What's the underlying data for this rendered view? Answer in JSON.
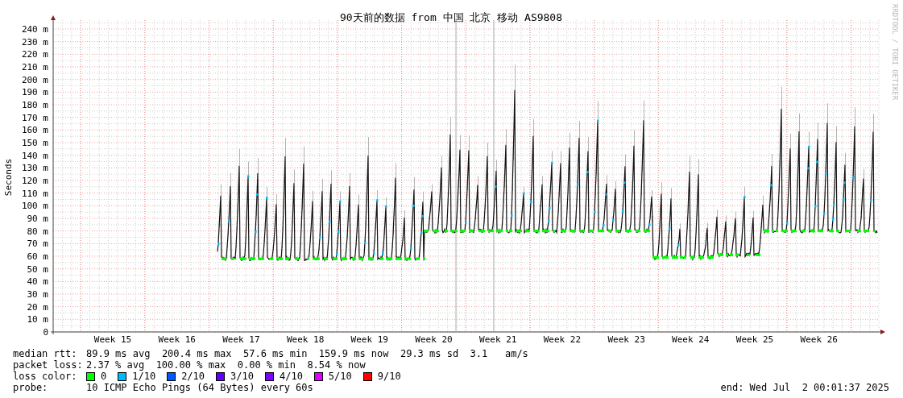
{
  "title": "90天前的数据 from 中国 北京 移动 AS9808",
  "credit": "RRDTOOL / TOBI OETIKER",
  "y_axis": {
    "label": "Seconds",
    "ticks": [
      "240 m",
      "230 m",
      "220 m",
      "210 m",
      "200 m",
      "190 m",
      "180 m",
      "170 m",
      "160 m",
      "150 m",
      "140 m",
      "130 m",
      "120 m",
      "110 m",
      "100 m",
      "90 m",
      "80 m",
      "70 m",
      "60 m",
      "50 m",
      "40 m",
      "30 m",
      "20 m",
      "10 m",
      "0"
    ]
  },
  "x_axis": {
    "ticks": [
      "Week 15",
      "Week 16",
      "Week 17",
      "Week 18",
      "Week 19",
      "Week 20",
      "Week 21",
      "Week 22",
      "Week 23",
      "Week 24",
      "Week 25",
      "Week 26"
    ]
  },
  "median_rtt": {
    "label": "median rtt:",
    "values": [
      "89.9 ms avg",
      "200.4 ms max",
      "57.6 ms min",
      "159.9 ms now",
      "29.3 ms sd",
      "3.1   am/s"
    ]
  },
  "packet_loss": {
    "label": "packet loss:",
    "values": [
      "2.37 % avg",
      "100.00 % max",
      "0.00 % min",
      "8.54 % now"
    ]
  },
  "loss_color": {
    "label": "loss color:",
    "items": [
      {
        "label": "0",
        "color": "#00ff00"
      },
      {
        "label": "1/10",
        "color": "#00bbff"
      },
      {
        "label": "2/10",
        "color": "#0059ff"
      },
      {
        "label": "3/10",
        "color": "#5e00ff"
      },
      {
        "label": "4/10",
        "color": "#7e00ff"
      },
      {
        "label": "5/10",
        "color": "#dd00ff"
      },
      {
        "label": "9/10",
        "color": "#ff0000"
      }
    ]
  },
  "probe": {
    "label": "probe:",
    "value": "10 ICMP Echo Pings (64 Bytes) every 60s"
  },
  "end": "end: Wed Jul  2 00:01:37 2025"
}
